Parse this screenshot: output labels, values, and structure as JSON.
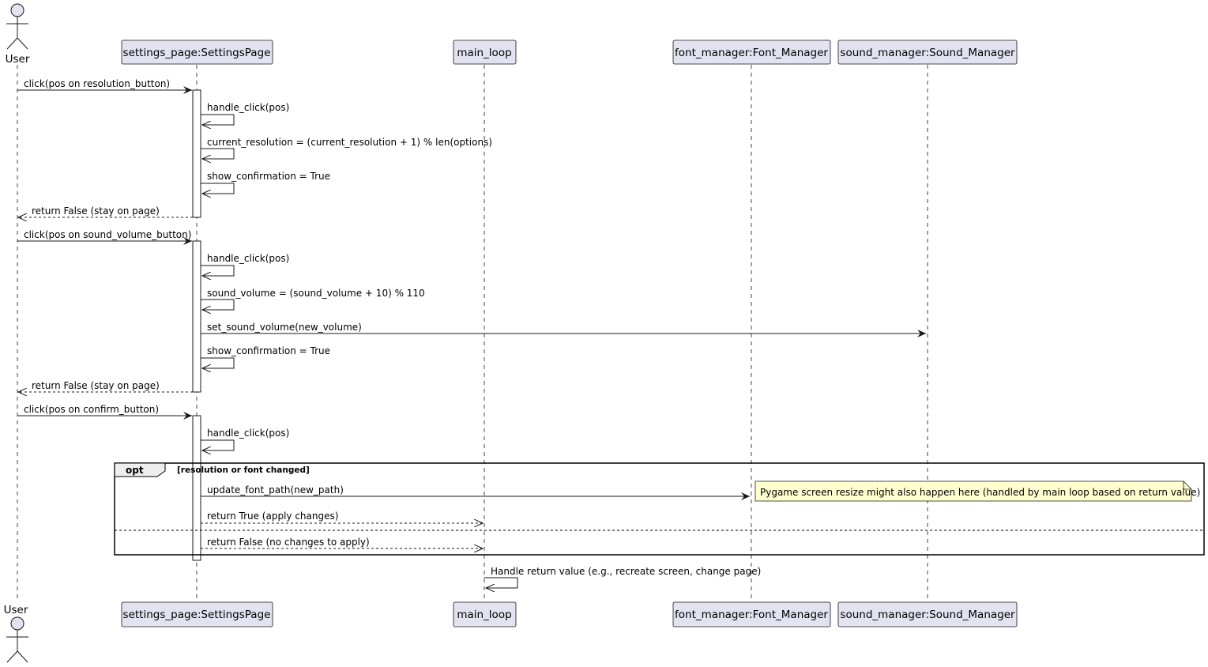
{
  "participants": {
    "user": "User",
    "settings_page": "settings_page:SettingsPage",
    "main_loop": "main_loop",
    "font_manager": "font_manager:Font_Manager",
    "sound_manager": "sound_manager:Sound_Manager"
  },
  "messages": [
    {
      "from": "user",
      "to": "settings_page",
      "label": "click(pos on resolution_button)",
      "kind": "sync"
    },
    {
      "from": "settings_page",
      "to": "settings_page",
      "label": "handle_click(pos)",
      "kind": "self"
    },
    {
      "from": "settings_page",
      "to": "settings_page",
      "label": "current_resolution = (current_resolution + 1) % len(options)",
      "kind": "self"
    },
    {
      "from": "settings_page",
      "to": "settings_page",
      "label": "show_confirmation = True",
      "kind": "self"
    },
    {
      "from": "settings_page",
      "to": "user",
      "label": "return False (stay on page)",
      "kind": "return"
    },
    {
      "from": "user",
      "to": "settings_page",
      "label": "click(pos on sound_volume_button)",
      "kind": "sync"
    },
    {
      "from": "settings_page",
      "to": "settings_page",
      "label": "handle_click(pos)",
      "kind": "self"
    },
    {
      "from": "settings_page",
      "to": "settings_page",
      "label": "sound_volume = (sound_volume + 10) % 110",
      "kind": "self"
    },
    {
      "from": "settings_page",
      "to": "sound_manager",
      "label": "set_sound_volume(new_volume)",
      "kind": "sync"
    },
    {
      "from": "settings_page",
      "to": "settings_page",
      "label": "show_confirmation = True",
      "kind": "self"
    },
    {
      "from": "settings_page",
      "to": "user",
      "label": "return False (stay on page)",
      "kind": "return"
    },
    {
      "from": "user",
      "to": "settings_page",
      "label": "click(pos on confirm_button)",
      "kind": "sync"
    },
    {
      "from": "settings_page",
      "to": "settings_page",
      "label": "handle_click(pos)",
      "kind": "self"
    },
    {
      "from": "settings_page",
      "to": "font_manager",
      "label": "update_font_path(new_path)",
      "kind": "sync"
    },
    {
      "from": "settings_page",
      "to": "main_loop",
      "label": "return True (apply changes)",
      "kind": "return"
    },
    {
      "from": "settings_page",
      "to": "main_loop",
      "label": "return False (no changes to apply)",
      "kind": "return"
    },
    {
      "from": "main_loop",
      "to": "main_loop",
      "label": "Handle return value (e.g., recreate screen, change page)",
      "kind": "self"
    }
  ],
  "fragment": {
    "keyword": "opt",
    "guard": "[resolution or font changed]"
  },
  "note": "Pygame screen resize might also happen here (handled by main loop based on return value)",
  "colors": {
    "participant_fill": "#e2e2f0",
    "participant_border": "#181818",
    "note_fill": "#fefece",
    "lifeline": "#181818",
    "fragment_border": "#000000"
  }
}
